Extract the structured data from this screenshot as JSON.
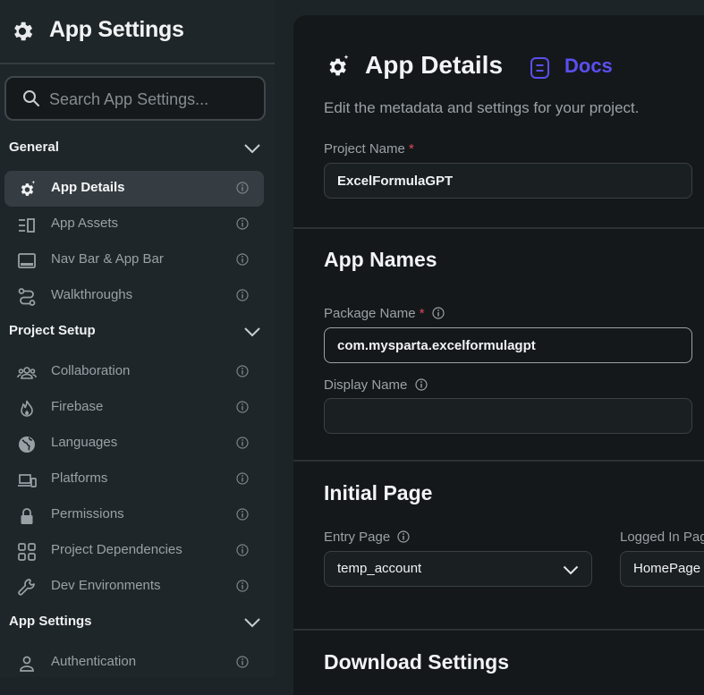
{
  "sidebar": {
    "title": "App Settings",
    "search_placeholder": "Search App Settings...",
    "sections": [
      {
        "label": "General",
        "items": [
          {
            "label": "App Details",
            "icon": "gear-sparkle-icon",
            "active": true
          },
          {
            "label": "App Assets",
            "icon": "assets-icon"
          },
          {
            "label": "Nav Bar & App Bar",
            "icon": "nav-bar-icon"
          },
          {
            "label": "Walkthroughs",
            "icon": "route-icon"
          }
        ]
      },
      {
        "label": "Project Setup",
        "items": [
          {
            "label": "Collaboration",
            "icon": "people-icon"
          },
          {
            "label": "Firebase",
            "icon": "flame-icon"
          },
          {
            "label": "Languages",
            "icon": "globe-icon"
          },
          {
            "label": "Platforms",
            "icon": "devices-icon"
          },
          {
            "label": "Permissions",
            "icon": "lock-icon"
          },
          {
            "label": "Project Dependencies",
            "icon": "grid-icon"
          },
          {
            "label": "Dev Environments",
            "icon": "wrench-icon"
          }
        ]
      },
      {
        "label": "App Settings",
        "items": [
          {
            "label": "Authentication",
            "icon": "person-icon"
          }
        ]
      }
    ]
  },
  "main": {
    "title": "App Details",
    "docs_label": "Docs",
    "subtitle": "Edit the metadata and settings for your project.",
    "project_name": {
      "label": "Project Name",
      "required": "*",
      "value": "ExcelFormulaGPT"
    },
    "app_names": {
      "heading": "App Names",
      "package_name": {
        "label": "Package Name",
        "required": "*",
        "value": "com.mysparta.excelformulagpt"
      },
      "display_name": {
        "label": "Display Name",
        "value": ""
      }
    },
    "initial_page": {
      "heading": "Initial Page",
      "entry_page": {
        "label": "Entry Page",
        "value": "temp_account"
      },
      "logged_in_page": {
        "label": "Logged In Page",
        "value": "HomePage"
      }
    },
    "download_settings": {
      "heading": "Download Settings"
    }
  },
  "colors": {
    "accent": "#5b4ff0",
    "required": "#e0475b",
    "sidebar_bg": "#1f262a",
    "panel_bg": "#14181b",
    "active_item_bg": "#363d42"
  }
}
